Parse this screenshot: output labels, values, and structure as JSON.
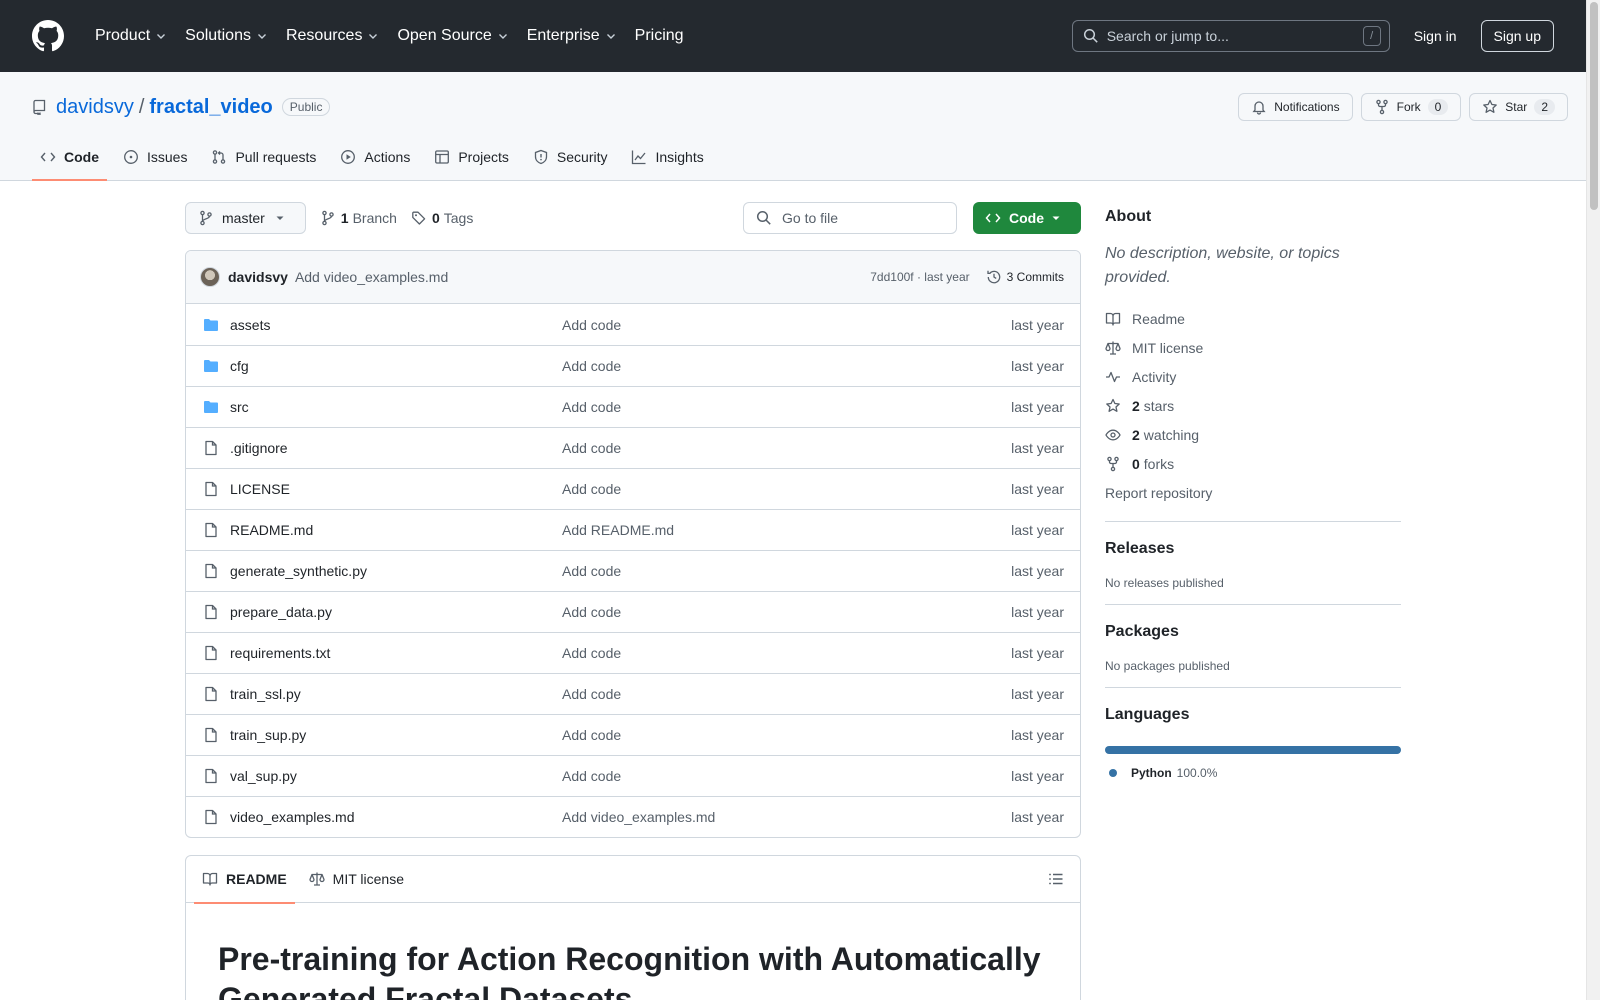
{
  "header": {
    "nav": [
      {
        "label": "Product",
        "has_menu": true
      },
      {
        "label": "Solutions",
        "has_menu": true
      },
      {
        "label": "Resources",
        "has_menu": true
      },
      {
        "label": "Open Source",
        "has_menu": true
      },
      {
        "label": "Enterprise",
        "has_menu": true
      },
      {
        "label": "Pricing",
        "has_menu": false
      }
    ],
    "search_placeholder": "Search or jump to...",
    "search_shortcut": "/",
    "sign_in": "Sign in",
    "sign_up": "Sign up"
  },
  "repo": {
    "owner": "davidsvy",
    "separator": "/",
    "name": "fractal_video",
    "visibility": "Public",
    "notifications_label": "Notifications",
    "fork_label": "Fork",
    "fork_count": "0",
    "star_label": "Star",
    "star_count": "2",
    "tabs": [
      {
        "label": "Code",
        "icon": "code-icon",
        "active": true
      },
      {
        "label": "Issues",
        "icon": "issue-icon",
        "active": false
      },
      {
        "label": "Pull requests",
        "icon": "pull-request-icon",
        "active": false
      },
      {
        "label": "Actions",
        "icon": "play-icon",
        "active": false
      },
      {
        "label": "Projects",
        "icon": "table-icon",
        "active": false
      },
      {
        "label": "Security",
        "icon": "shield-icon",
        "active": false
      },
      {
        "label": "Insights",
        "icon": "graph-icon",
        "active": false
      }
    ]
  },
  "filenav": {
    "branch": "master",
    "branch_count": "1",
    "branch_label": "Branch",
    "tag_count": "0",
    "tag_label": "Tags",
    "goto_placeholder": "Go to file",
    "code_button": "Code"
  },
  "commit": {
    "author": "davidsvy",
    "message": "Add video_examples.md",
    "hash_time": "7dd100f · last year",
    "commits_label": "3 Commits"
  },
  "files": [
    {
      "type": "dir",
      "name": "assets",
      "message": "Add code",
      "date": "last year"
    },
    {
      "type": "dir",
      "name": "cfg",
      "message": "Add code",
      "date": "last year"
    },
    {
      "type": "dir",
      "name": "src",
      "message": "Add code",
      "date": "last year"
    },
    {
      "type": "file",
      "name": ".gitignore",
      "message": "Add code",
      "date": "last year"
    },
    {
      "type": "file",
      "name": "LICENSE",
      "message": "Add code",
      "date": "last year"
    },
    {
      "type": "file",
      "name": "README.md",
      "message": "Add README.md",
      "date": "last year"
    },
    {
      "type": "file",
      "name": "generate_synthetic.py",
      "message": "Add code",
      "date": "last year"
    },
    {
      "type": "file",
      "name": "prepare_data.py",
      "message": "Add code",
      "date": "last year"
    },
    {
      "type": "file",
      "name": "requirements.txt",
      "message": "Add code",
      "date": "last year"
    },
    {
      "type": "file",
      "name": "train_ssl.py",
      "message": "Add code",
      "date": "last year"
    },
    {
      "type": "file",
      "name": "train_sup.py",
      "message": "Add code",
      "date": "last year"
    },
    {
      "type": "file",
      "name": "val_sup.py",
      "message": "Add code",
      "date": "last year"
    },
    {
      "type": "file",
      "name": "video_examples.md",
      "message": "Add video_examples.md",
      "date": "last year"
    }
  ],
  "readme": {
    "tab_readme": "README",
    "tab_license": "MIT license",
    "heading": "Pre-training for Action Recognition with Automatically Generated Fractal Datasets"
  },
  "about": {
    "title": "About",
    "description": "No description, website, or topics provided.",
    "readme": "Readme",
    "license": "MIT license",
    "activity": "Activity",
    "stars_count": "2",
    "stars_label": "stars",
    "watching_count": "2",
    "watching_label": "watching",
    "forks_count": "0",
    "forks_label": "forks",
    "report": "Report repository"
  },
  "releases": {
    "title": "Releases",
    "note": "No releases published"
  },
  "packages": {
    "title": "Packages",
    "note": "No packages published"
  },
  "languages": {
    "title": "Languages",
    "items": [
      {
        "name": "Python",
        "percent": "100.0%",
        "color": "#3572a5"
      }
    ]
  },
  "colors": {
    "header_bg": "#24292f",
    "link": "#0969da",
    "primary_button": "#1f883d",
    "tab_underline": "#fd8c73"
  }
}
